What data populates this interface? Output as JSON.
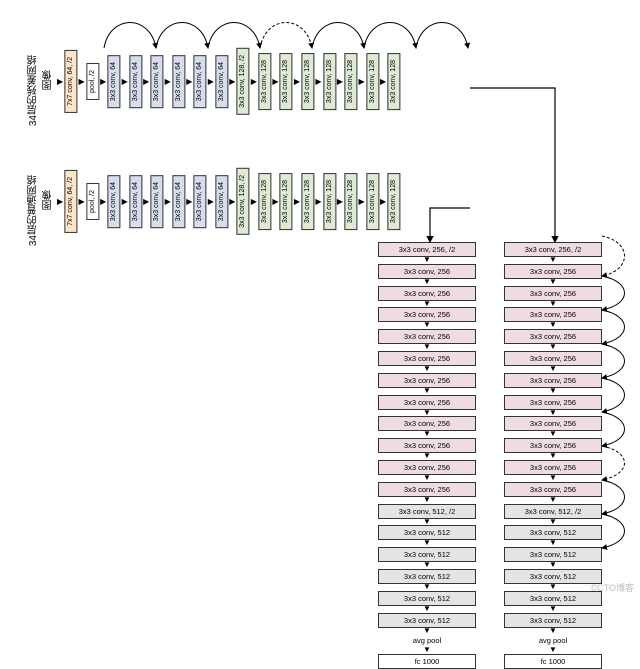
{
  "labels": {
    "residual_title": "34层的残差网络",
    "plain_title": "34层的普通网络",
    "image_word": "图像"
  },
  "layers": {
    "stem0": "7x7 conv, 64, /2",
    "stem1": "pool, /2",
    "c64": "3x3 conv, 64",
    "c128s": "3x3 conv, 128, /2",
    "c128": "3x3 conv, 128",
    "c256s": "3x3 conv, 256, /2",
    "c256": "3x3 conv, 256",
    "c512s": "3x3 conv, 512, /2",
    "c512": "3x3 conv, 512",
    "avgpool": "avg pool",
    "fc": "fc 1000"
  },
  "watermark": "©CTO博客",
  "chart_data": {
    "type": "diagram",
    "networks": [
      {
        "name": "34-layer residual network",
        "label_cn": "34层的残差网络",
        "input": "图像",
        "sequence": [
          "7x7 conv, 64, /2",
          "pool, /2",
          "3x3 conv, 64",
          "3x3 conv, 64",
          "3x3 conv, 64",
          "3x3 conv, 64",
          "3x3 conv, 64",
          "3x3 conv, 64",
          "3x3 conv, 128, /2",
          "3x3 conv, 128",
          "3x3 conv, 128",
          "3x3 conv, 128",
          "3x3 conv, 128",
          "3x3 conv, 128",
          "3x3 conv, 128",
          "3x3 conv, 128",
          "3x3 conv, 256, /2",
          "3x3 conv, 256",
          "3x3 conv, 256",
          "3x3 conv, 256",
          "3x3 conv, 256",
          "3x3 conv, 256",
          "3x3 conv, 256",
          "3x3 conv, 256",
          "3x3 conv, 256",
          "3x3 conv, 256",
          "3x3 conv, 256",
          "3x3 conv, 256",
          "3x3 conv, 512, /2",
          "3x3 conv, 512",
          "3x3 conv, 512",
          "3x3 conv, 512",
          "3x3 conv, 512",
          "3x3 conv, 512",
          "avg pool",
          "fc 1000"
        ],
        "skip_connections": [
          {
            "from_index": 1,
            "to_index": 3,
            "type": "identity"
          },
          {
            "from_index": 3,
            "to_index": 5,
            "type": "identity"
          },
          {
            "from_index": 5,
            "to_index": 7,
            "type": "identity"
          },
          {
            "from_index": 7,
            "to_index": 9,
            "type": "projection"
          },
          {
            "from_index": 9,
            "to_index": 11,
            "type": "identity"
          },
          {
            "from_index": 11,
            "to_index": 13,
            "type": "identity"
          },
          {
            "from_index": 13,
            "to_index": 15,
            "type": "identity"
          },
          {
            "from_index": 15,
            "to_index": 17,
            "type": "projection"
          },
          {
            "from_index": 17,
            "to_index": 19,
            "type": "identity"
          },
          {
            "from_index": 19,
            "to_index": 21,
            "type": "identity"
          },
          {
            "from_index": 21,
            "to_index": 23,
            "type": "identity"
          },
          {
            "from_index": 23,
            "to_index": 25,
            "type": "identity"
          },
          {
            "from_index": 25,
            "to_index": 27,
            "type": "identity"
          },
          {
            "from_index": 27,
            "to_index": 29,
            "type": "projection"
          },
          {
            "from_index": 29,
            "to_index": 31,
            "type": "identity"
          },
          {
            "from_index": 31,
            "to_index": 33,
            "type": "identity"
          }
        ]
      },
      {
        "name": "34-layer plain network",
        "label_cn": "34层的普通网络",
        "input": "图像",
        "sequence": [
          "7x7 conv, 64, /2",
          "pool, /2",
          "3x3 conv, 64",
          "3x3 conv, 64",
          "3x3 conv, 64",
          "3x3 conv, 64",
          "3x3 conv, 64",
          "3x3 conv, 64",
          "3x3 conv, 128, /2",
          "3x3 conv, 128",
          "3x3 conv, 128",
          "3x3 conv, 128",
          "3x3 conv, 128",
          "3x3 conv, 128",
          "3x3 conv, 128",
          "3x3 conv, 128",
          "3x3 conv, 256, /2",
          "3x3 conv, 256",
          "3x3 conv, 256",
          "3x3 conv, 256",
          "3x3 conv, 256",
          "3x3 conv, 256",
          "3x3 conv, 256",
          "3x3 conv, 256",
          "3x3 conv, 256",
          "3x3 conv, 256",
          "3x3 conv, 256",
          "3x3 conv, 256",
          "3x3 conv, 512, /2",
          "3x3 conv, 512",
          "3x3 conv, 512",
          "3x3 conv, 512",
          "3x3 conv, 512",
          "3x3 conv, 512",
          "avg pool",
          "fc 1000"
        ],
        "skip_connections": []
      }
    ]
  }
}
